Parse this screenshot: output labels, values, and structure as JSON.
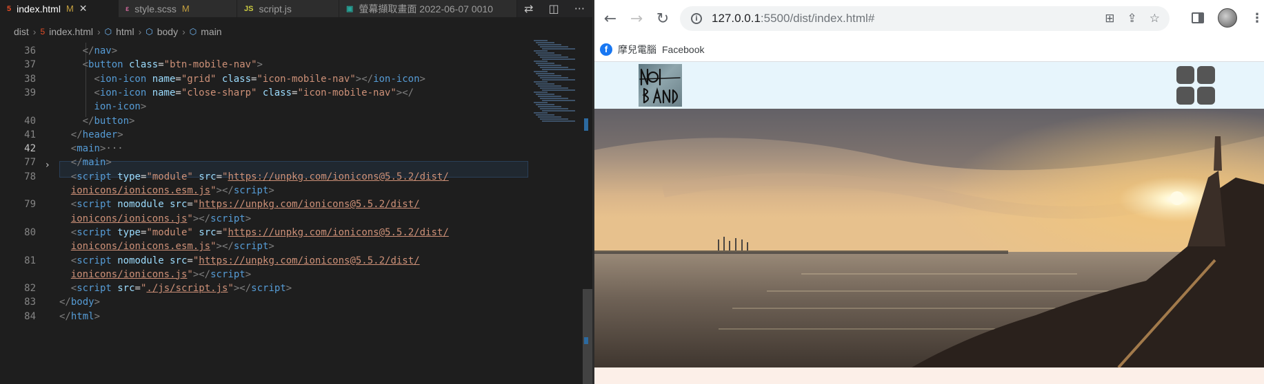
{
  "editor": {
    "tabs": [
      {
        "icon": "html-file-icon",
        "label": "index.html",
        "modified": "M",
        "active": true
      },
      {
        "icon": "scss-file-icon",
        "label": "style.scss",
        "modified": "M",
        "active": false
      },
      {
        "icon": "js-file-icon",
        "label": "script.js",
        "modified": "",
        "active": false
      },
      {
        "icon": "image-file-icon",
        "label": "螢幕擷取畫面 2022-06-07 0010",
        "modified": "",
        "active": false
      }
    ],
    "breadcrumb": [
      "dist",
      "index.html",
      "html",
      "body",
      "main"
    ],
    "current_line": 42,
    "lines": [
      {
        "n": "36",
        "html": "<span class='t'>&lt;/</span><span class='tn'>nav</span><span class='t'>&gt;</span>",
        "indent": 4
      },
      {
        "n": "37",
        "html": "<span class='t'>&lt;</span><span class='tn'>button</span> <span class='an'>class</span>=<span class='av'>\"btn-mobile-nav\"</span><span class='t'>&gt;</span>",
        "indent": 4
      },
      {
        "n": "38",
        "html": "<span class='t'>&lt;</span><span class='tn'>ion-icon</span> <span class='an'>name</span>=<span class='av'>\"grid\"</span> <span class='an'>class</span>=<span class='av'>\"icon-mobile-nav\"</span><span class='t'>&gt;&lt;/</span><span class='tn'>ion-icon</span><span class='t'>&gt;</span>",
        "indent": 6
      },
      {
        "n": "39",
        "html": "<span class='t'>&lt;</span><span class='tn'>ion-icon</span> <span class='an'>name</span>=<span class='av'>\"close-sharp\"</span> <span class='an'>class</span>=<span class='av'>\"icon-mobile-nav\"</span><span class='t'>&gt;&lt;/</span>",
        "indent": 6
      },
      {
        "n": "",
        "html": "<span class='tn'>ion-icon</span><span class='t'>&gt;</span>",
        "indent": 6
      },
      {
        "n": "40",
        "html": "<span class='t'>&lt;/</span><span class='tn'>button</span><span class='t'>&gt;</span>",
        "indent": 4
      },
      {
        "n": "41",
        "html": "<span class='t'>&lt;/</span><span class='tn'>header</span><span class='t'>&gt;</span>",
        "indent": 2
      },
      {
        "n": "42",
        "html": "<span class='t'>&lt;</span><span class='tn'>main</span><span class='t'>&gt;</span><span class='ell'>···</span>",
        "indent": 2
      },
      {
        "n": "77",
        "html": "<span class='t'>&lt;/</span><span class='tn'>main</span><span class='t'>&gt;</span>",
        "indent": 2
      },
      {
        "n": "78",
        "html": "<span class='t'>&lt;</span><span class='tn'>script</span> <span class='an'>type</span>=<span class='av'>\"module\"</span> <span class='an'>src</span>=<span class='av'>\"</span><span class='au'>https://unpkg.com/ionicons@5.5.2/dist/</span>",
        "indent": 2
      },
      {
        "n": "",
        "html": "<span class='au'>ionicons/ionicons.esm.js</span><span class='av'>\"</span><span class='t'>&gt;&lt;/</span><span class='tn'>script</span><span class='t'>&gt;</span>",
        "indent": 2
      },
      {
        "n": "79",
        "html": "<span class='t'>&lt;</span><span class='tn'>script</span> <span class='an'>nomodule</span> <span class='an'>src</span>=<span class='av'>\"</span><span class='au'>https://unpkg.com/ionicons@5.5.2/dist/</span>",
        "indent": 2
      },
      {
        "n": "",
        "html": "<span class='au'>ionicons/ionicons.js</span><span class='av'>\"</span><span class='t'>&gt;&lt;/</span><span class='tn'>script</span><span class='t'>&gt;</span>",
        "indent": 2
      },
      {
        "n": "80",
        "html": "<span class='t'>&lt;</span><span class='tn'>script</span> <span class='an'>type</span>=<span class='av'>\"module\"</span> <span class='an'>src</span>=<span class='av'>\"</span><span class='au'>https://unpkg.com/ionicons@5.5.2/dist/</span>",
        "indent": 2
      },
      {
        "n": "",
        "html": "<span class='au'>ionicons/ionicons.esm.js</span><span class='av'>\"</span><span class='t'>&gt;&lt;/</span><span class='tn'>script</span><span class='t'>&gt;</span>",
        "indent": 2
      },
      {
        "n": "81",
        "html": "<span class='t'>&lt;</span><span class='tn'>script</span> <span class='an'>nomodule</span> <span class='an'>src</span>=<span class='av'>\"</span><span class='au'>https://unpkg.com/ionicons@5.5.2/dist/</span>",
        "indent": 2
      },
      {
        "n": "",
        "html": "<span class='au'>ionicons/ionicons.js</span><span class='av'>\"</span><span class='t'>&gt;&lt;/</span><span class='tn'>script</span><span class='t'>&gt;</span>",
        "indent": 2
      },
      {
        "n": "82",
        "html": "<span class='t'>&lt;</span><span class='tn'>script</span> <span class='an'>src</span>=<span class='av'>\"</span><span class='au'>./js/script.js</span><span class='av'>\"</span><span class='t'>&gt;&lt;/</span><span class='tn'>script</span><span class='t'>&gt;</span>",
        "indent": 2
      },
      {
        "n": "83",
        "html": "<span class='t'>&lt;/</span><span class='tn'>body</span><span class='t'>&gt;</span>",
        "indent": 0
      },
      {
        "n": "84",
        "html": "<span class='t'>&lt;/</span><span class='tn'>html</span><span class='t'>&gt;</span>",
        "indent": 0
      }
    ]
  },
  "browser": {
    "url_host": "127.0.0.1",
    "url_rest": ":5500/dist/index.html#",
    "bookmark_label": "摩兒電腦",
    "bookmark_name": "Facebook",
    "logo_text": "NOI BAND",
    "colors": {
      "header_bg": "#e7f5fc",
      "below_hero_bg": "#fcefe8"
    }
  }
}
